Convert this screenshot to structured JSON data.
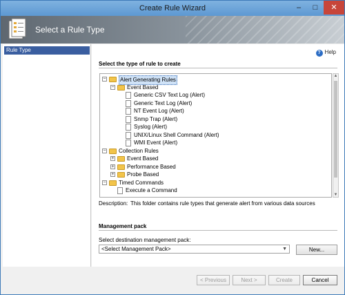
{
  "window": {
    "title": "Create Rule Wizard",
    "controls": [
      "–",
      "□",
      "✕"
    ]
  },
  "header": {
    "title": "Select a Rule Type",
    "icon": "wizard-page-icon"
  },
  "nav": {
    "items": [
      {
        "label": "Rule Type",
        "selected": true
      }
    ]
  },
  "help": {
    "label": "Help",
    "icon": "help-icon"
  },
  "section1": {
    "title": "Select the type of rule to create"
  },
  "tree": [
    {
      "label": "Alert Generating Rules",
      "level": 0,
      "expanded": true,
      "type": "folder",
      "selected": true
    },
    {
      "label": "Event Based",
      "level": 1,
      "expanded": true,
      "type": "folder"
    },
    {
      "label": "Generic CSV Text Log (Alert)",
      "level": 2,
      "type": "item"
    },
    {
      "label": "Generic Text Log (Alert)",
      "level": 2,
      "type": "item"
    },
    {
      "label": "NT Event Log (Alert)",
      "level": 2,
      "type": "item"
    },
    {
      "label": "Snmp Trap (Alert)",
      "level": 2,
      "type": "item"
    },
    {
      "label": "Syslog (Alert)",
      "level": 2,
      "type": "item"
    },
    {
      "label": "UNIX/Linux Shell Command (Alert)",
      "level": 2,
      "type": "item"
    },
    {
      "label": "WMI Event (Alert)",
      "level": 2,
      "type": "item"
    },
    {
      "label": "Collection Rules",
      "level": 0,
      "expanded": true,
      "type": "folder"
    },
    {
      "label": "Event Based",
      "level": 1,
      "expanded": false,
      "type": "folder"
    },
    {
      "label": "Performance Based",
      "level": 1,
      "expanded": false,
      "type": "folder"
    },
    {
      "label": "Probe Based",
      "level": 1,
      "expanded": false,
      "type": "folder"
    },
    {
      "label": "Timed Commands",
      "level": 0,
      "expanded": true,
      "type": "folder"
    },
    {
      "label": "Execute a Command",
      "level": 1,
      "type": "item"
    }
  ],
  "description": {
    "label": "Description:",
    "text": "This folder contains rule types that generate alert from various data sources"
  },
  "management_pack": {
    "title": "Management pack",
    "select_label": "Select destination management pack:",
    "select_value": "<Select Management Pack>",
    "new_button": "New..."
  },
  "footer": {
    "previous": "< Previous",
    "next": "Next >",
    "create": "Create",
    "cancel": "Cancel"
  }
}
